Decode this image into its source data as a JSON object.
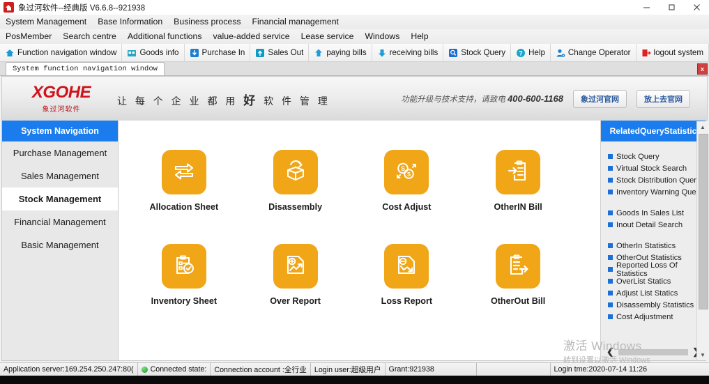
{
  "window": {
    "title": "象过河软件--经典版 V6.6.8--921938",
    "icon": "app-house-icon",
    "minimize": "–",
    "maximize": "□",
    "close": "✕"
  },
  "menubar": {
    "row1": [
      "System Management",
      "Base Information",
      "Business process",
      "Financial management"
    ],
    "row2": [
      "PosMember",
      "Search centre",
      "Additional functions",
      "value-added service",
      "Lease service",
      "Windows",
      "Help"
    ]
  },
  "toolbar": {
    "items": [
      {
        "label": "Function navigation window",
        "icon": "home-icon"
      },
      {
        "label": "Goods info",
        "icon": "goods-icon"
      },
      {
        "label": "Purchase In",
        "icon": "purchase-in-icon"
      },
      {
        "label": "Sales Out",
        "icon": "sales-out-icon"
      },
      {
        "label": "paying bills",
        "icon": "paying-bills-icon"
      },
      {
        "label": "receiving bills",
        "icon": "receiving-bills-icon"
      },
      {
        "label": "Stock Query",
        "icon": "stock-query-icon"
      },
      {
        "label": "Help",
        "icon": "help-icon"
      },
      {
        "label": "Change  Operator",
        "icon": "change-operator-icon"
      },
      {
        "label": "logout  system",
        "icon": "logout-icon"
      }
    ],
    "overflow": "»"
  },
  "tab": {
    "label": "System function navigation window",
    "close": "x"
  },
  "banner": {
    "logo_mark": "XGOHE",
    "logo_sub": "象过河软件",
    "slogan_pre": "让 每 个 企 业 都 用 ",
    "slogan_hl": "好",
    "slogan_post": " 软 件 管 理",
    "support_text": "功能升级与技术支持，请致电 ",
    "support_phone": "400-600-1168",
    "btn_official": "象过河官网",
    "btn_goto": "放上去官网"
  },
  "sidebar": {
    "header": "System Navigation",
    "items": [
      {
        "label": "Purchase Management",
        "active": false
      },
      {
        "label": "Sales Management",
        "active": false
      },
      {
        "label": "Stock Management",
        "active": true
      },
      {
        "label": "Financial Management",
        "active": false
      },
      {
        "label": "Basic Management",
        "active": false
      }
    ]
  },
  "main": {
    "tiles": [
      {
        "label": "Allocation Sheet",
        "icon": "allocation-arrows-icon"
      },
      {
        "label": "Disassembly",
        "icon": "open-box-arrow-icon"
      },
      {
        "label": "Cost Adjust",
        "icon": "coins-adjust-icon"
      },
      {
        "label": "OtherIN Bill",
        "icon": "clipboard-arrow-in-icon"
      },
      {
        "label": "Inventory Sheet",
        "icon": "clipboard-check-icon"
      },
      {
        "label": "Over Report",
        "icon": "document-plus-chart-icon"
      },
      {
        "label": "Loss Report",
        "icon": "document-minus-chart-icon"
      },
      {
        "label": "OtherOut Bill",
        "icon": "clipboard-arrow-out-icon"
      }
    ],
    "tile_color": "#f0a617"
  },
  "right_panel": {
    "header": "RelatedQueryStatistic",
    "groups": [
      [
        "Stock Query",
        "Virtual Stock Search",
        "Stock Distribution Query",
        "Inventory Warning Query"
      ],
      [
        "Goods In Sales List",
        "Inout Detail Search"
      ],
      [
        "OtherIn Statistics",
        "OtherOut Statistics",
        "Reported Loss Of Statistics",
        "OverList Statics",
        "Adjust List Statics",
        "Disassembly Statistics",
        "Cost Adjustment"
      ]
    ],
    "nav_prev": "❮",
    "nav_next": "❯"
  },
  "watermark": {
    "line1": "激活 Windows",
    "line2": "转到设置以激活 Windows"
  },
  "statusbar": {
    "cells": [
      "Application server:169.254.250.247:80(",
      "Connected state:",
      "Connection account :全行业",
      "Login user:超级用户",
      "Grant:921938",
      "",
      "Login tme:2020-07-14 11:26"
    ]
  },
  "colors": {
    "accent_blue": "#1a7ced",
    "tile_orange": "#f0a617",
    "logo_red": "#d0121b"
  }
}
